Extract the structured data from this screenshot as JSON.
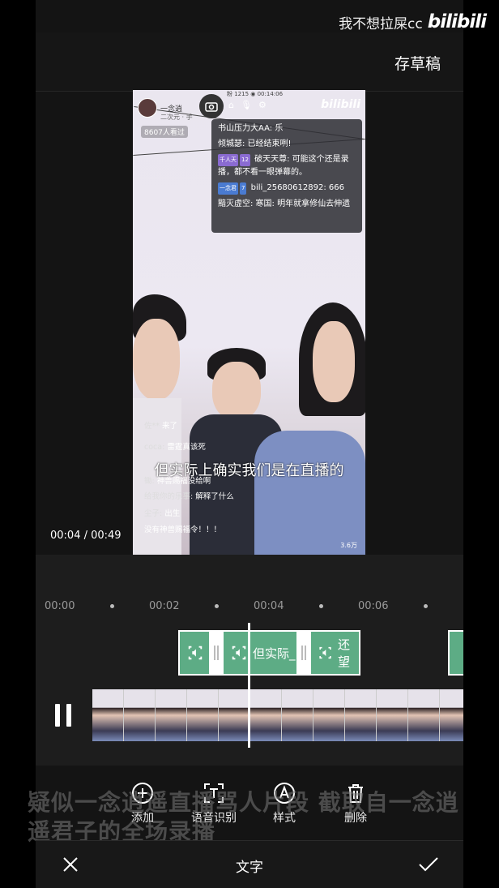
{
  "watermark": {
    "uploader": "我不想拉屎cc",
    "logo": "bilibili"
  },
  "header": {
    "save_draft_label": "存草稿"
  },
  "preview": {
    "stream_header": {
      "streamer_name": "一念逍",
      "sub": "二次元 · 手",
      "stats": "粉 1215   ◉ 00:14:06"
    },
    "viewers": "8607人看过",
    "logo": "bilibili",
    "chat": [
      {
        "text": "书山压力大AA: 乐"
      },
      {
        "text": "倾城瑟: 已经结束咧!"
      },
      {
        "badge": "千人天",
        "level": "12",
        "text": "破天天尊: 可能这个还是录播，都不看一眼弹幕的。",
        "badge_color": "#8a6bd1"
      },
      {
        "badge": "一念君",
        "level": "7",
        "text": "bili_25680612892: 666",
        "badge_color": "#4a7bd1"
      },
      {
        "text": "黯灭虚空: 寒国: 明年就拿修仙去伸遗"
      }
    ],
    "danmaku": [
      {
        "name": "佐** ",
        "text": "来了"
      },
      {
        "name": "coca: ",
        "text": "雷霆真该死"
      },
      {
        "name": "锄: ",
        "text": "神兽赐福没给啊"
      },
      {
        "name": "给我你的乐事: ",
        "text": "解释了什么"
      },
      {
        "name": "尘子: ",
        "text": "出生"
      },
      {
        "name": "",
        "text": "没有神兽赐福令！！！"
      }
    ],
    "caption": "但实际上确实我们是在直播的",
    "view_count": "3.6万"
  },
  "playback": {
    "time": "00:04 / 00:49"
  },
  "timeline": {
    "ruler": [
      "00:00",
      "00:02",
      "00:04",
      "00:06"
    ],
    "clips": [
      {
        "label": ""
      },
      {
        "label": "但实际_"
      },
      {
        "label": "还望"
      }
    ]
  },
  "overlay_text": "疑似一念逍遥直播骂人片段 截取自一念逍遥君子的全场录播",
  "toolbar": {
    "add_label": "添加",
    "speech_label": "语音识别",
    "style_label": "样式",
    "delete_label": "删除"
  },
  "bottom": {
    "title": "文字"
  },
  "colors": {
    "clip_green": "#5dac85",
    "background": "#141414"
  }
}
